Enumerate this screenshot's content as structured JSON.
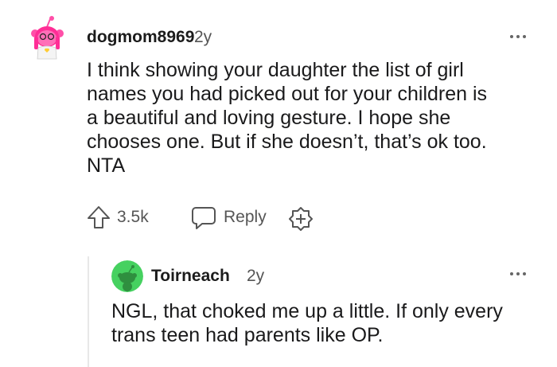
{
  "comment": {
    "username": "dogmom8969",
    "age": "2y",
    "text": "I think showing your daughter the list of girl\nnames you had picked out for your children is\na beautiful and loving gesture. I hope she\nchooses one. But if she doesn’t, that’s ok too.\nNTA",
    "upvote_count": "3.5k",
    "reply_label": "Reply",
    "icons": {
      "avatar": "avatar-icon",
      "upvote": "upvote-arrow-icon",
      "reply": "speech-bubble-icon",
      "award": "add-award-icon",
      "more": "more-options-icon"
    }
  },
  "reply": {
    "username": "Toirneach",
    "age": "2y",
    "text": "NGL, that choked me up a little. If only every\ntrans teen had parents like OP.",
    "icons": {
      "avatar": "snoo-avatar-icon",
      "more": "more-options-icon"
    }
  },
  "colors": {
    "text": "#1a1a1b",
    "meta": "#555555",
    "reply_avatar_bg": "#46d160",
    "avatar_pink": "#ff4fa8"
  }
}
